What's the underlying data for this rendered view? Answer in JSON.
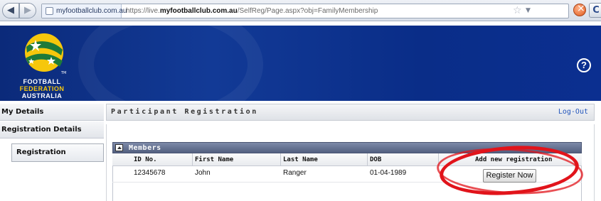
{
  "browser": {
    "site_identity": "myfootballclub.com.au",
    "url_prefix": "https://live.",
    "url_domain": "myfootballclub.com.au",
    "url_path": "/SelfReg/Page.aspx?obj=FamilyMembership",
    "icons": [
      "back-arrow-icon",
      "forward-arrow-icon",
      "site-icon",
      "star-icon",
      "dropdown-icon",
      "stop-icon",
      "reload-icon"
    ]
  },
  "header": {
    "logo_line1": "FOOTBALL",
    "logo_line2": "FEDERATION",
    "logo_line3": "AUSTRALIA",
    "help_label": "?",
    "colors": {
      "banner": "#0b2f90",
      "gold": "#f6c70c",
      "green": "#1d7a3a"
    }
  },
  "sidebar": {
    "items": [
      {
        "label": "My Details"
      },
      {
        "label": "Registration Details"
      },
      {
        "label": "Registration"
      }
    ]
  },
  "main": {
    "page_title": "Participant Registration",
    "logout_label": "Log-Out",
    "members": {
      "title": "Members",
      "columns": [
        "ID No.",
        "First Name",
        "Last Name",
        "DOB",
        "Add new registration"
      ],
      "rows": [
        {
          "id": "12345678",
          "first_name": "John",
          "last_name": "Ranger",
          "dob": "01-04-1989",
          "action_label": "Register Now"
        }
      ]
    },
    "highlight_color": "#e1141b"
  }
}
